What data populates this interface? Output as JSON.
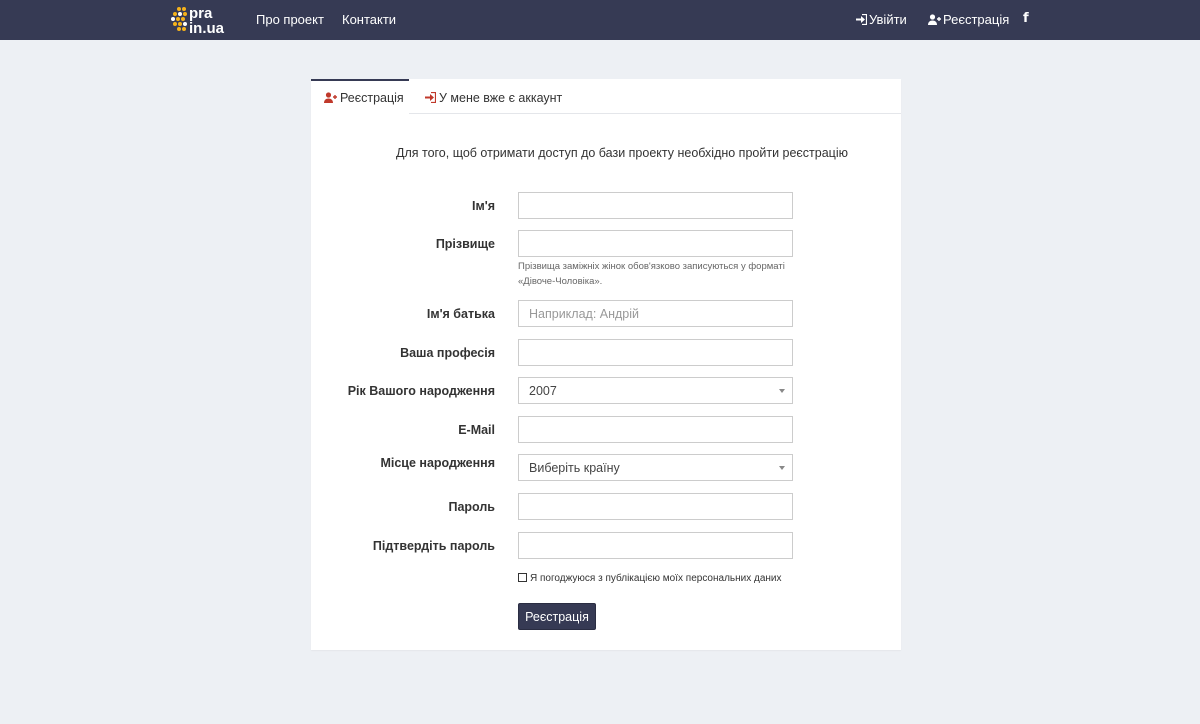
{
  "navbar": {
    "logo_text_top": "pra",
    "logo_text_bottom": "in.ua",
    "links": {
      "about": "Про проект",
      "contacts": "Контакти"
    },
    "login": "Увійти",
    "register": "Реєстрація",
    "facebook_glyph": "f"
  },
  "tabs": {
    "register": "Реєстрація",
    "login": "У мене вже є аккаунт"
  },
  "form": {
    "intro": "Для того, щоб отримати доступ до бази проекту необхідно пройти реєстрацію",
    "first_name": {
      "label": "Ім'я",
      "value": ""
    },
    "last_name": {
      "label": "Прізвище",
      "value": "",
      "help": "Прізвища заміжніх жінок обов'язково записуються у форматі «Дівоче-Чоловіка»."
    },
    "patronymic": {
      "label": "Ім'я батька",
      "placeholder": "Наприклад: Андрій",
      "value": ""
    },
    "profession": {
      "label": "Ваша професія",
      "value": ""
    },
    "birth_year": {
      "label": "Рік Вашого народження",
      "selected": "2007"
    },
    "email": {
      "label": "E-Mail",
      "value": ""
    },
    "birthplace": {
      "label": "Місце народження",
      "selected": "Виберіть країну"
    },
    "password": {
      "label": "Пароль",
      "value": ""
    },
    "confirm_password": {
      "label": "Підтвердіть пароль",
      "value": ""
    },
    "agree_label": "Я погоджуюся з публікацією моїх персональних даних",
    "agree_checked": false,
    "submit": "Реєстрація"
  },
  "colors": {
    "navbar": "#363a54",
    "page_bg": "#edf0f4",
    "logo_accent": "#f5b21b",
    "icon_red": "#c0392b",
    "button": "#363a54"
  },
  "icons": {
    "login": "sign-in-icon",
    "register": "user-plus-icon",
    "facebook": "facebook-icon"
  }
}
